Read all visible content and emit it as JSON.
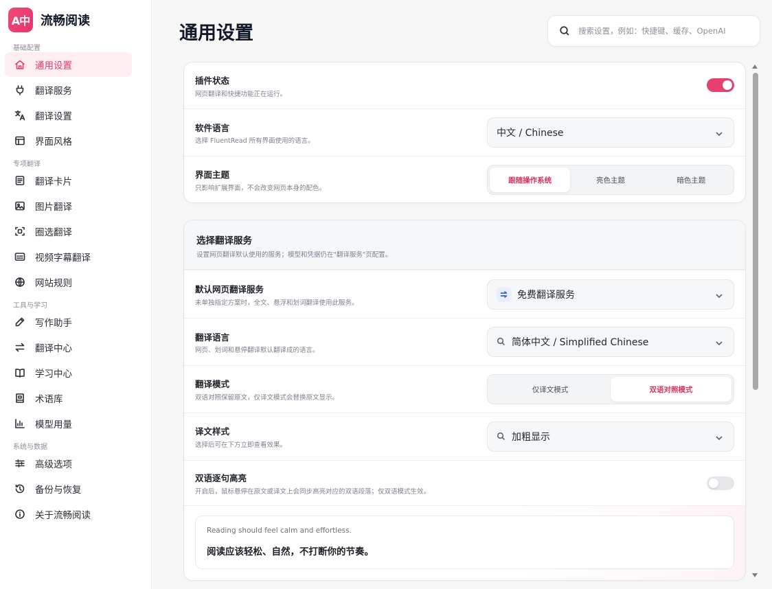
{
  "app": {
    "logo_text": "A中",
    "name": "流畅阅读"
  },
  "sidebar": {
    "sections": [
      "基础配置",
      "专项翻译",
      "工具与学习",
      "系统与数据"
    ],
    "items": [
      {
        "label": "通用设置",
        "icon": "home-icon"
      },
      {
        "label": "翻译服务",
        "icon": "plug-icon"
      },
      {
        "label": "翻译设置",
        "icon": "translate-icon"
      },
      {
        "label": "界面风格",
        "icon": "layout-icon"
      },
      {
        "label": "翻译卡片",
        "icon": "card-icon"
      },
      {
        "label": "图片翻译",
        "icon": "image-icon"
      },
      {
        "label": "圈选翻译",
        "icon": "select-region-icon"
      },
      {
        "label": "视频字幕翻译",
        "icon": "subtitle-icon"
      },
      {
        "label": "网站规则",
        "icon": "globe-icon"
      },
      {
        "label": "写作助手",
        "icon": "pen-icon"
      },
      {
        "label": "翻译中心",
        "icon": "swap-icon"
      },
      {
        "label": "学习中心",
        "icon": "book-icon"
      },
      {
        "label": "术语库",
        "icon": "glossary-icon"
      },
      {
        "label": "模型用量",
        "icon": "bar-chart-icon"
      },
      {
        "label": "高级选项",
        "icon": "sliders-icon"
      },
      {
        "label": "备份与恢复",
        "icon": "history-icon"
      },
      {
        "label": "关于流畅阅读",
        "icon": "info-icon"
      }
    ]
  },
  "header": {
    "title": "通用设置",
    "search_placeholder": "搜索设置，例如：快捷键、缓存、OpenAI"
  },
  "general_card": {
    "plugin_status": {
      "title": "插件状态",
      "desc": "网页翻译和快捷功能正在运行。",
      "enabled": true
    },
    "language": {
      "title": "软件语言",
      "desc": "选择 FluentRead 所有界面使用的语言。",
      "value": "中文 / Chinese"
    },
    "theme": {
      "title": "界面主题",
      "desc": "只影响扩展界面，不会改变网页本身的配色。",
      "options": [
        "跟随操作系统",
        "亮色主题",
        "暗色主题"
      ],
      "selected": "跟随操作系统"
    }
  },
  "service_card": {
    "title": "选择翻译服务",
    "desc": "设置网页翻译默认使用的服务；模型和凭据仍在\"翻译服务\"页配置。",
    "default_service": {
      "title": "默认网页翻译服务",
      "desc": "未单独指定方案时，全文、悬浮和划词翻译使用此服务。",
      "value": "免费翻译服务"
    },
    "target_language": {
      "title": "翻译语言",
      "desc": "网页、划词和悬停翻译默认翻译成的语言。",
      "value": "简体中文 / Simplified Chinese"
    },
    "mode": {
      "title": "翻译模式",
      "desc": "双语对照保留原文，仅译文模式会替换原文显示。",
      "options": [
        "仅译文模式",
        "双语对照模式"
      ],
      "selected": "双语对照模式"
    },
    "style": {
      "title": "译文样式",
      "desc": "选择后可在下方立即查看效果。",
      "value": "加粗显示"
    },
    "highlight": {
      "title": "双语逐句高亮",
      "desc": "开启后，鼠标悬停在原文或译文上会同步高亮对应的双语段落；仅双语模式生效。",
      "enabled": false
    },
    "preview": {
      "original": "Reading should feel calm and effortless.",
      "translated": "阅读应该轻松、自然，不打断你的节奏。"
    }
  },
  "colors": {
    "accent": "#e8416f",
    "active_bg": "#fdeef2"
  }
}
